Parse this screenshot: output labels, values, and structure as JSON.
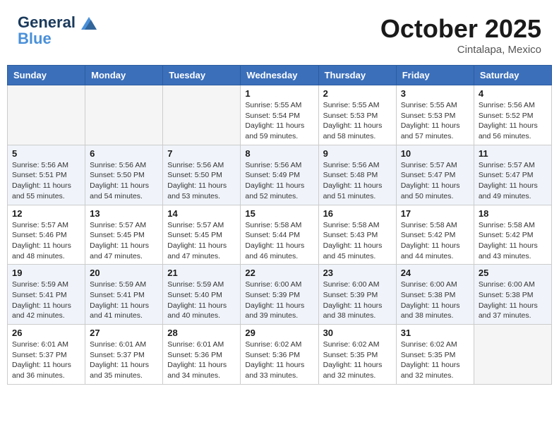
{
  "header": {
    "logo_line1": "General",
    "logo_line2": "Blue",
    "month": "October 2025",
    "location": "Cintalapa, Mexico"
  },
  "weekdays": [
    "Sunday",
    "Monday",
    "Tuesday",
    "Wednesday",
    "Thursday",
    "Friday",
    "Saturday"
  ],
  "weeks": [
    [
      {
        "day": "",
        "info": ""
      },
      {
        "day": "",
        "info": ""
      },
      {
        "day": "",
        "info": ""
      },
      {
        "day": "1",
        "info": "Sunrise: 5:55 AM\nSunset: 5:54 PM\nDaylight: 11 hours\nand 59 minutes."
      },
      {
        "day": "2",
        "info": "Sunrise: 5:55 AM\nSunset: 5:53 PM\nDaylight: 11 hours\nand 58 minutes."
      },
      {
        "day": "3",
        "info": "Sunrise: 5:55 AM\nSunset: 5:53 PM\nDaylight: 11 hours\nand 57 minutes."
      },
      {
        "day": "4",
        "info": "Sunrise: 5:56 AM\nSunset: 5:52 PM\nDaylight: 11 hours\nand 56 minutes."
      }
    ],
    [
      {
        "day": "5",
        "info": "Sunrise: 5:56 AM\nSunset: 5:51 PM\nDaylight: 11 hours\nand 55 minutes."
      },
      {
        "day": "6",
        "info": "Sunrise: 5:56 AM\nSunset: 5:50 PM\nDaylight: 11 hours\nand 54 minutes."
      },
      {
        "day": "7",
        "info": "Sunrise: 5:56 AM\nSunset: 5:50 PM\nDaylight: 11 hours\nand 53 minutes."
      },
      {
        "day": "8",
        "info": "Sunrise: 5:56 AM\nSunset: 5:49 PM\nDaylight: 11 hours\nand 52 minutes."
      },
      {
        "day": "9",
        "info": "Sunrise: 5:56 AM\nSunset: 5:48 PM\nDaylight: 11 hours\nand 51 minutes."
      },
      {
        "day": "10",
        "info": "Sunrise: 5:57 AM\nSunset: 5:47 PM\nDaylight: 11 hours\nand 50 minutes."
      },
      {
        "day": "11",
        "info": "Sunrise: 5:57 AM\nSunset: 5:47 PM\nDaylight: 11 hours\nand 49 minutes."
      }
    ],
    [
      {
        "day": "12",
        "info": "Sunrise: 5:57 AM\nSunset: 5:46 PM\nDaylight: 11 hours\nand 48 minutes."
      },
      {
        "day": "13",
        "info": "Sunrise: 5:57 AM\nSunset: 5:45 PM\nDaylight: 11 hours\nand 47 minutes."
      },
      {
        "day": "14",
        "info": "Sunrise: 5:57 AM\nSunset: 5:45 PM\nDaylight: 11 hours\nand 47 minutes."
      },
      {
        "day": "15",
        "info": "Sunrise: 5:58 AM\nSunset: 5:44 PM\nDaylight: 11 hours\nand 46 minutes."
      },
      {
        "day": "16",
        "info": "Sunrise: 5:58 AM\nSunset: 5:43 PM\nDaylight: 11 hours\nand 45 minutes."
      },
      {
        "day": "17",
        "info": "Sunrise: 5:58 AM\nSunset: 5:42 PM\nDaylight: 11 hours\nand 44 minutes."
      },
      {
        "day": "18",
        "info": "Sunrise: 5:58 AM\nSunset: 5:42 PM\nDaylight: 11 hours\nand 43 minutes."
      }
    ],
    [
      {
        "day": "19",
        "info": "Sunrise: 5:59 AM\nSunset: 5:41 PM\nDaylight: 11 hours\nand 42 minutes."
      },
      {
        "day": "20",
        "info": "Sunrise: 5:59 AM\nSunset: 5:41 PM\nDaylight: 11 hours\nand 41 minutes."
      },
      {
        "day": "21",
        "info": "Sunrise: 5:59 AM\nSunset: 5:40 PM\nDaylight: 11 hours\nand 40 minutes."
      },
      {
        "day": "22",
        "info": "Sunrise: 6:00 AM\nSunset: 5:39 PM\nDaylight: 11 hours\nand 39 minutes."
      },
      {
        "day": "23",
        "info": "Sunrise: 6:00 AM\nSunset: 5:39 PM\nDaylight: 11 hours\nand 38 minutes."
      },
      {
        "day": "24",
        "info": "Sunrise: 6:00 AM\nSunset: 5:38 PM\nDaylight: 11 hours\nand 38 minutes."
      },
      {
        "day": "25",
        "info": "Sunrise: 6:00 AM\nSunset: 5:38 PM\nDaylight: 11 hours\nand 37 minutes."
      }
    ],
    [
      {
        "day": "26",
        "info": "Sunrise: 6:01 AM\nSunset: 5:37 PM\nDaylight: 11 hours\nand 36 minutes."
      },
      {
        "day": "27",
        "info": "Sunrise: 6:01 AM\nSunset: 5:37 PM\nDaylight: 11 hours\nand 35 minutes."
      },
      {
        "day": "28",
        "info": "Sunrise: 6:01 AM\nSunset: 5:36 PM\nDaylight: 11 hours\nand 34 minutes."
      },
      {
        "day": "29",
        "info": "Sunrise: 6:02 AM\nSunset: 5:36 PM\nDaylight: 11 hours\nand 33 minutes."
      },
      {
        "day": "30",
        "info": "Sunrise: 6:02 AM\nSunset: 5:35 PM\nDaylight: 11 hours\nand 32 minutes."
      },
      {
        "day": "31",
        "info": "Sunrise: 6:02 AM\nSunset: 5:35 PM\nDaylight: 11 hours\nand 32 minutes."
      },
      {
        "day": "",
        "info": ""
      }
    ]
  ]
}
